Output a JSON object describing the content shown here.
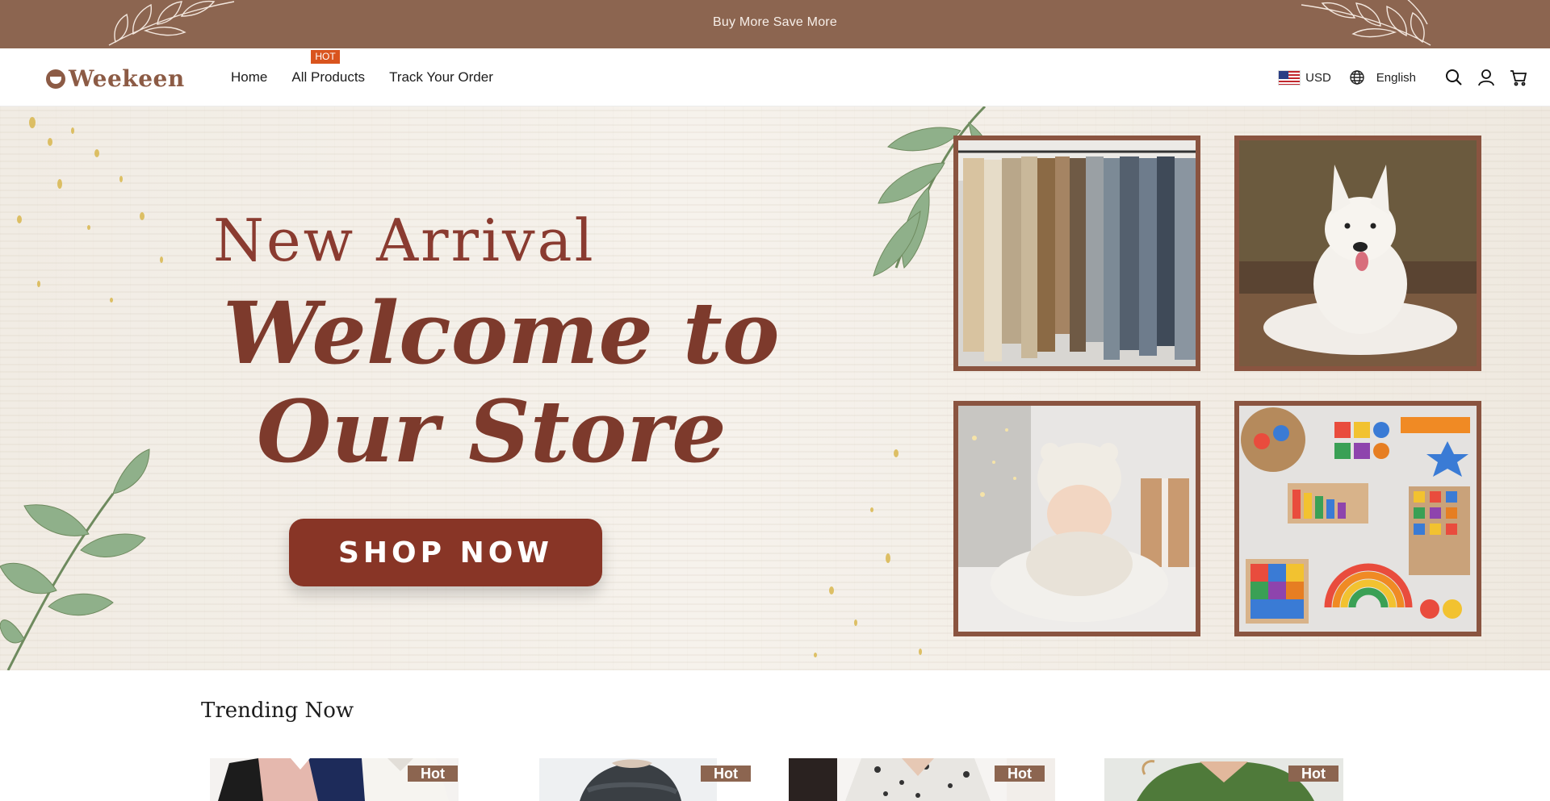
{
  "announcement": {
    "text": "Buy More Save More"
  },
  "brand": {
    "name": "Weekeen",
    "color": "#8c5b45"
  },
  "nav": {
    "items": [
      {
        "label": "Home"
      },
      {
        "label": "All Products",
        "tag": "HOT"
      },
      {
        "label": "Track Your Order"
      }
    ]
  },
  "header_right": {
    "currency": "USD",
    "language": "English",
    "icons": [
      "globe-icon",
      "search-icon",
      "account-icon",
      "cart-icon"
    ]
  },
  "hero": {
    "title_line1": "New Arrival",
    "title_line2": "Welcome to",
    "title_line3": "Our Store",
    "cta_label": "SHOP NOW",
    "images": [
      "clothing-rack",
      "white-dog",
      "baby-in-hat",
      "wooden-toys"
    ],
    "accent_color": "#883526"
  },
  "trending": {
    "title": "Trending Now",
    "products": [
      {
        "badge": "Hot"
      },
      {
        "badge": "Hot"
      },
      {
        "badge": "Hot"
      },
      {
        "badge": "Hot"
      }
    ]
  },
  "colors": {
    "announcement_bg": "#8c6550",
    "badge_bg": "#8c6550",
    "hot_tag": "#d9541e"
  }
}
